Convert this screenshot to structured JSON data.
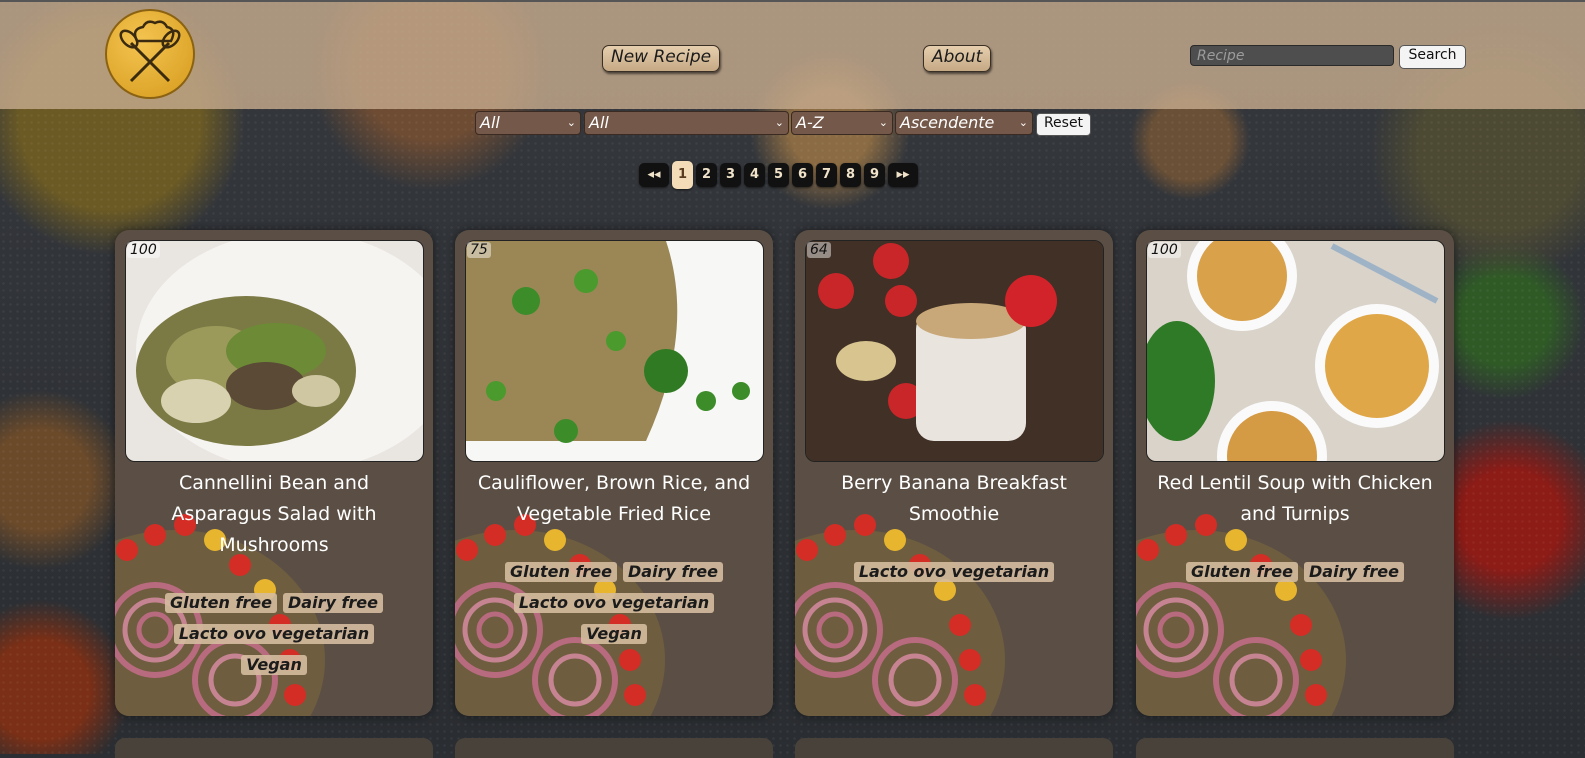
{
  "header": {
    "logo_icon": "chef-whisk-logo-icon",
    "nav": [
      {
        "label": "New Recipe"
      },
      {
        "label": "About"
      }
    ],
    "search": {
      "placeholder": "Recipe",
      "button_label": "Search"
    }
  },
  "filters": {
    "diet": "All",
    "type": "All",
    "order": "A-Z",
    "direction": "Ascendente",
    "reset_label": "Reset"
  },
  "pagination": {
    "prev_label": "◂◂",
    "pages": [
      "1",
      "2",
      "3",
      "4",
      "5",
      "6",
      "7",
      "8",
      "9"
    ],
    "current": "1",
    "next_label": "▸▸"
  },
  "recipes": [
    {
      "score": "100",
      "title": "Cannellini Bean and Asparagus Salad with Mushrooms",
      "tags": [
        "Gluten free",
        "Dairy free",
        "Lacto ovo vegetarian",
        "Vegan"
      ]
    },
    {
      "score": "75",
      "title": "Cauliflower, Brown Rice, and Vegetable Fried Rice",
      "tags": [
        "Gluten free",
        "Dairy free",
        "Lacto ovo vegetarian",
        "Vegan"
      ]
    },
    {
      "score": "64",
      "title": "Berry Banana Breakfast Smoothie",
      "tags": [
        "Lacto ovo vegetarian"
      ]
    },
    {
      "score": "100",
      "title": "Red Lentil Soup with Chicken and Turnips",
      "tags": [
        "Gluten free",
        "Dairy free"
      ]
    }
  ]
}
